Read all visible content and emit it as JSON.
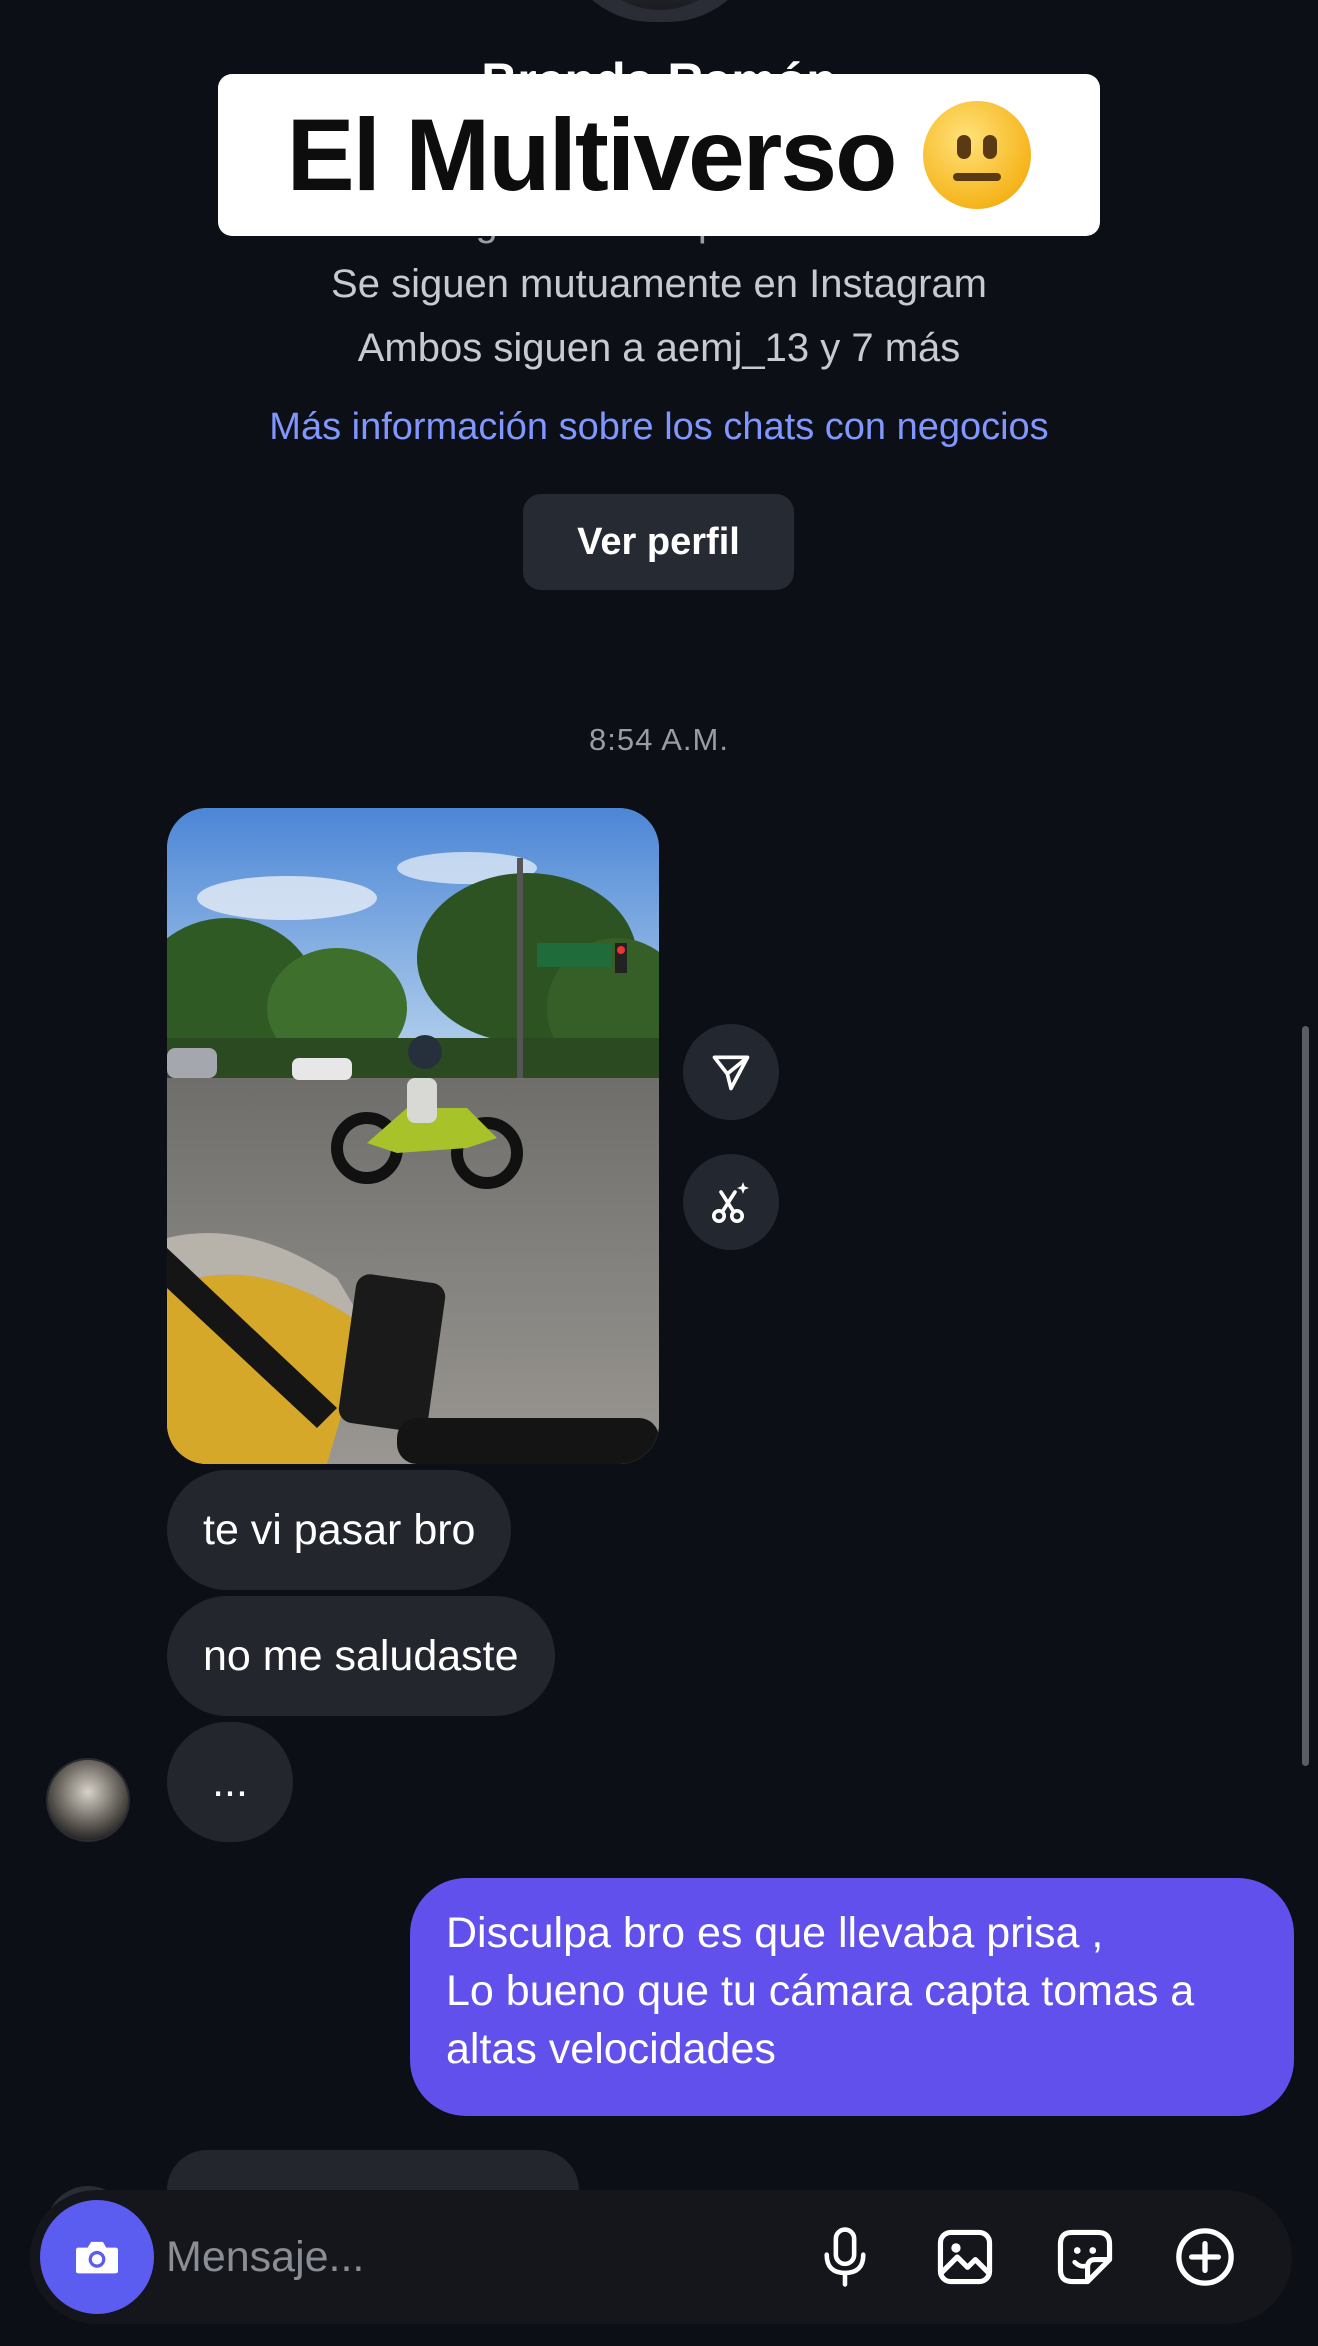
{
  "header": {
    "banner_title": "El Multiverso",
    "banner_emoji": "neutral-face-emoji",
    "covered_name": "Brenda Ramón",
    "covered_stats": "72 seguidores · 2 publicaciones",
    "mutual_follow": "Se siguen mutuamente en Instagram",
    "mutual_friends": "Ambos siguen a aemj_13 y 7 más",
    "business_info_link": "Más información sobre los chats con negocios",
    "view_profile_button": "Ver perfil"
  },
  "conversation": {
    "timestamp": "8:54 A.M.",
    "incoming": [
      {
        "text": "te vi pasar bro"
      },
      {
        "text": "no me saludaste"
      },
      {
        "text": "..."
      }
    ],
    "outgoing": [
      {
        "lines": [
          "Disculpa bro es que llevaba prisa ,",
          "Lo bueno que tu cámara capta tomas a",
          "altas velocidades"
        ]
      }
    ],
    "photo_icons": [
      "send-icon",
      "cutout-sparkle-icon"
    ]
  },
  "composer": {
    "placeholder": "Mensaje...",
    "icons": [
      "camera-icon",
      "microphone-icon",
      "gallery-icon",
      "sticker-icon",
      "plus-icon"
    ],
    "accent_color": "#5b5df1"
  },
  "colors": {
    "background": "#0c0f16",
    "incoming_bubble": "#23262d",
    "outgoing_bubble": "#6250ec",
    "link": "#7f97ff"
  }
}
